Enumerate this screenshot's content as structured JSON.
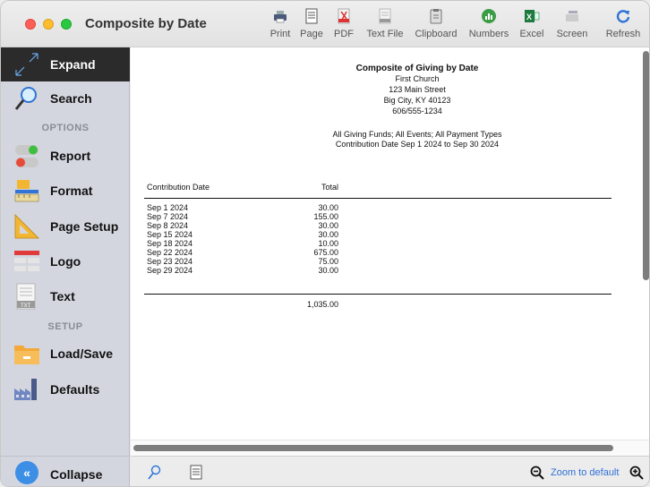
{
  "window": {
    "title": "Composite by Date"
  },
  "toolbar": {
    "print": "Print",
    "page": "Page",
    "pdf": "PDF",
    "text_file": "Text File",
    "clipboard": "Clipboard",
    "numbers": "Numbers",
    "excel": "Excel",
    "screen": "Screen",
    "refresh": "Refresh"
  },
  "sidebar": {
    "expand": "Expand",
    "search": "Search",
    "options_heading": "OPTIONS",
    "report": "Report",
    "format": "Format",
    "page_setup": "Page Setup",
    "logo": "Logo",
    "text": "Text",
    "setup_heading": "SETUP",
    "load_save": "Load/Save",
    "defaults": "Defaults",
    "collapse": "Collapse"
  },
  "report": {
    "title": "Composite of Giving by Date",
    "org": "First Church",
    "address1": "123 Main Street",
    "address2": "Big City, KY  40123",
    "phone": "606/555-1234",
    "filter1": "All Giving Funds; All Events; All Payment Types",
    "filter2": "Contribution Date Sep 1 2024 to Sep 30 2024",
    "col_date": "Contribution Date",
    "col_total": "Total",
    "rows": [
      {
        "date": "Sep 1 2024",
        "total": "30.00"
      },
      {
        "date": "Sep 7 2024",
        "total": "155.00"
      },
      {
        "date": "Sep 8 2024",
        "total": "30.00"
      },
      {
        "date": "Sep 15 2024",
        "total": "30.00"
      },
      {
        "date": "Sep 18 2024",
        "total": "10.00"
      },
      {
        "date": "Sep 22 2024",
        "total": "675.00"
      },
      {
        "date": "Sep 23 2024",
        "total": "75.00"
      },
      {
        "date": "Sep 29 2024",
        "total": "30.00"
      }
    ],
    "grand_total": "1,035.00"
  },
  "bottom": {
    "zoom_default": "Zoom to default"
  },
  "colors": {
    "accent": "#3d8fe6",
    "sidebar_bg": "#d4d6df",
    "active_bg": "#2b2b2b"
  }
}
